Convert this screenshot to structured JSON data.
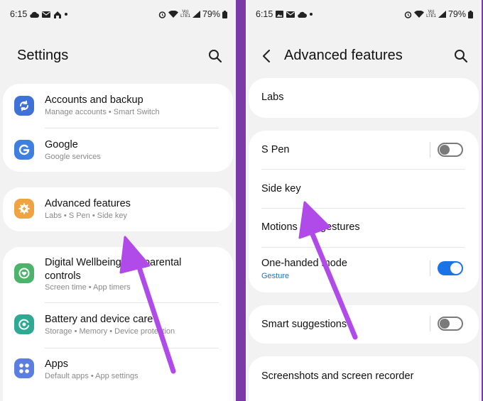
{
  "left": {
    "status": {
      "time": "6:15",
      "battery": "79%",
      "volte": "Vo)\nLTE1"
    },
    "title": "Settings",
    "items": [
      {
        "title": "Accounts and backup",
        "subtitle": "Manage accounts  •  Smart Switch",
        "icon": "sync-icon",
        "color": "#3f72d6"
      },
      {
        "title": "Google",
        "subtitle": "Google services",
        "icon": "google-icon",
        "color": "#3f7fe0"
      },
      {
        "title": "Advanced features",
        "subtitle": "Labs  •  S Pen  •  Side key",
        "icon": "gear-plus-icon",
        "color": "#f0a441"
      },
      {
        "title": "Digital Wellbeing and parental controls",
        "subtitle": "Screen time  •  App timers",
        "icon": "wellbeing-icon",
        "color": "#4cb36a"
      },
      {
        "title": "Battery and device care",
        "subtitle": "Storage  •  Memory  •  Device protection",
        "icon": "device-care-icon",
        "color": "#2eaa94"
      },
      {
        "title": "Apps",
        "subtitle": "Default apps  •  App settings",
        "icon": "apps-icon",
        "color": "#5b7fe0"
      }
    ]
  },
  "right": {
    "status": {
      "time": "6:15",
      "battery": "79%",
      "volte": "Vo)\nLTE1"
    },
    "title": "Advanced features",
    "items": [
      {
        "title": "Labs"
      },
      {
        "title": "S Pen",
        "toggle": "off"
      },
      {
        "title": "Side key"
      },
      {
        "title": "Motions and gestures"
      },
      {
        "title": "One-handed mode",
        "subtitle": "Gesture",
        "toggle": "on"
      },
      {
        "title": "Smart suggestions",
        "toggle": "off"
      },
      {
        "title": "Screenshots and screen recorder"
      }
    ]
  },
  "accent_color": "#b04ae8"
}
